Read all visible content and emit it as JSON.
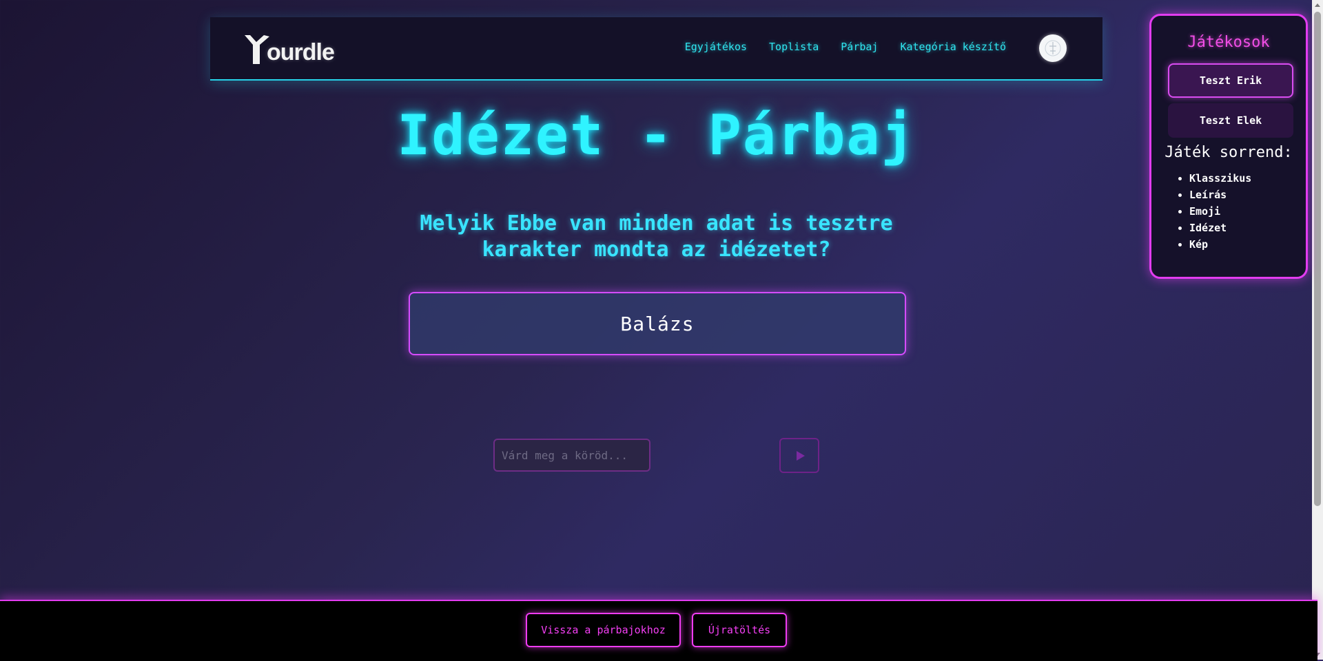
{
  "navbar": {
    "logo_text": "ourdle",
    "links": [
      "Egyjátékos",
      "Toplista",
      "Párbaj",
      "Kategória készítő"
    ],
    "avatar_icon": "user-avatar-icon"
  },
  "main": {
    "title": "Idézet - Párbaj",
    "question": "Melyik Ebbe van minden adat is tesztre karakter mondta az idézetet?",
    "answer": "Balázs",
    "input_placeholder": "Várd meg a köröd...",
    "send_icon": "play-icon"
  },
  "players": {
    "title": "Játékosok",
    "list": [
      "Teszt Erik",
      "Teszt Elek"
    ],
    "order_title": "Játék sorrend:",
    "order": [
      "Klasszikus",
      "Leírás",
      "Emoji",
      "Idézet",
      "Kép"
    ]
  },
  "footer": {
    "back_label": "Vissza a párbajokhoz",
    "reload_label": "Újratöltés"
  },
  "colors": {
    "accent_cyan": "#2ff3ff",
    "accent_magenta": "#e23cf0",
    "background": "#2a2550"
  }
}
